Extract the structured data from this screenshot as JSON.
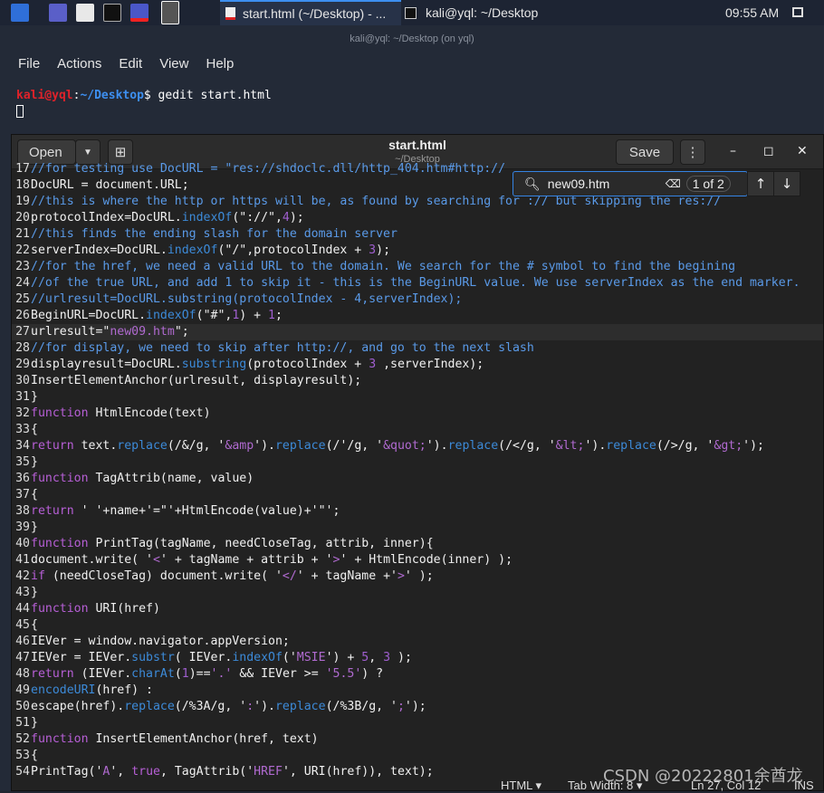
{
  "taskbar": {
    "tasks": [
      {
        "label": "start.html (~/Desktop) - ...",
        "icon": "text-file-icon"
      },
      {
        "label": "kali@yql: ~/Desktop",
        "icon": "terminal-icon"
      }
    ],
    "clock": "09:55 AM"
  },
  "terminal": {
    "title": "kali@yql: ~/Desktop (on yql)",
    "menu": [
      "File",
      "Actions",
      "Edit",
      "View",
      "Help"
    ],
    "prompt_user": "kali@yql",
    "prompt_sep": ":",
    "prompt_path": "~/Desktop",
    "prompt_sym": "$",
    "command": " gedit start.html"
  },
  "gedit": {
    "open_label": "Open",
    "title": "start.html",
    "subtitle": "~/Desktop",
    "save_label": "Save",
    "search": {
      "value": "new09.htm",
      "count": "1 of 2"
    },
    "lines": [
      {
        "n": "17",
        "segs": [
          [
            "//for testing use DocURL = \"res://shdoclc.dll/http_404.htm#http://",
            "c"
          ]
        ]
      },
      {
        "n": "18",
        "segs": [
          [
            "DocURL = document.URL;",
            ""
          ]
        ]
      },
      {
        "n": "19",
        "segs": [
          [
            "//this is where the http or https will be, as found by searching for :// but skipping the res://",
            "c"
          ]
        ]
      },
      {
        "n": "20",
        "segs": [
          [
            "protocolIndex=DocURL.",
            ""
          ],
          [
            "indexOf",
            "m"
          ],
          [
            "(\"://\",",
            ""
          ],
          [
            "4",
            "n"
          ],
          [
            ");",
            ""
          ]
        ]
      },
      {
        "n": "21",
        "segs": [
          [
            "//this finds the ending slash for the domain server",
            "c"
          ]
        ]
      },
      {
        "n": "22",
        "segs": [
          [
            "serverIndex=DocURL.",
            ""
          ],
          [
            "indexOf",
            "m"
          ],
          [
            "(\"/\",protocolIndex + ",
            ""
          ],
          [
            "3",
            "n"
          ],
          [
            ");",
            ""
          ]
        ]
      },
      {
        "n": "23",
        "segs": [
          [
            "//for the href, we need a valid URL to the domain. We search for the # symbol to find the begining",
            "c"
          ]
        ]
      },
      {
        "n": "24",
        "segs": [
          [
            "//of the true URL, and add 1 to skip it - this is the BeginURL value. We use serverIndex as the end marker.",
            "c"
          ]
        ]
      },
      {
        "n": "25",
        "segs": [
          [
            "//urlresult=DocURL.substring(protocolIndex - 4,serverIndex);",
            "c"
          ]
        ]
      },
      {
        "n": "26",
        "segs": [
          [
            "BeginURL=DocURL.",
            ""
          ],
          [
            "indexOf",
            "m"
          ],
          [
            "(\"#\",",
            ""
          ],
          [
            "1",
            "n"
          ],
          [
            ") + ",
            ""
          ],
          [
            "1",
            "n"
          ],
          [
            ";",
            ""
          ]
        ]
      },
      {
        "n": "27",
        "segs": [
          [
            "urlresult=\"",
            ""
          ],
          [
            "new09.htm",
            "s"
          ],
          [
            "\";",
            ""
          ]
        ]
      },
      {
        "n": "28",
        "segs": [
          [
            "//for display, we need to skip after http://, and go to the next slash",
            "c"
          ]
        ]
      },
      {
        "n": "29",
        "segs": [
          [
            "displayresult=DocURL.",
            ""
          ],
          [
            "substring",
            "m"
          ],
          [
            "(protocolIndex + ",
            ""
          ],
          [
            "3",
            "n"
          ],
          [
            " ,serverIndex);",
            ""
          ]
        ]
      },
      {
        "n": "30",
        "segs": [
          [
            "InsertElementAnchor(urlresult, displayresult);",
            ""
          ]
        ]
      },
      {
        "n": "31",
        "segs": [
          [
            "}",
            ""
          ]
        ]
      },
      {
        "n": "32",
        "segs": [
          [
            "function",
            "k"
          ],
          [
            " HtmlEncode(text)",
            ""
          ]
        ]
      },
      {
        "n": "33",
        "segs": [
          [
            "{",
            ""
          ]
        ]
      },
      {
        "n": "34",
        "segs": [
          [
            "return",
            "k"
          ],
          [
            " text.",
            ""
          ],
          [
            "replace",
            "m"
          ],
          [
            "(/&/g, '",
            ""
          ],
          [
            "&amp",
            "s"
          ],
          [
            "').",
            ""
          ],
          [
            "replace",
            "m"
          ],
          [
            "(/'/g, '",
            ""
          ],
          [
            "&quot;",
            "s"
          ],
          [
            "').",
            ""
          ],
          [
            "replace",
            "m"
          ],
          [
            "(/</g, '",
            ""
          ],
          [
            "&lt;",
            "s"
          ],
          [
            "').",
            ""
          ],
          [
            "replace",
            "m"
          ],
          [
            "(/>/g, '",
            ""
          ],
          [
            "&gt;",
            "s"
          ],
          [
            "');",
            ""
          ]
        ]
      },
      {
        "n": "35",
        "segs": [
          [
            "}",
            ""
          ]
        ]
      },
      {
        "n": "36",
        "segs": [
          [
            "function",
            "k"
          ],
          [
            " TagAttrib(name, value)",
            ""
          ]
        ]
      },
      {
        "n": "37",
        "segs": [
          [
            "{",
            ""
          ]
        ]
      },
      {
        "n": "38",
        "segs": [
          [
            "return",
            "k"
          ],
          [
            " ' '+name+'=\"'+HtmlEncode(value)+'\"';",
            ""
          ]
        ]
      },
      {
        "n": "39",
        "segs": [
          [
            "}",
            ""
          ]
        ]
      },
      {
        "n": "40",
        "segs": [
          [
            "function",
            "k"
          ],
          [
            " PrintTag(tagName, needCloseTag, attrib, inner){",
            ""
          ]
        ]
      },
      {
        "n": "41",
        "segs": [
          [
            "document.write( '",
            ""
          ],
          [
            "<",
            "s"
          ],
          [
            "' + tagName + attrib + '",
            ""
          ],
          [
            ">",
            "s"
          ],
          [
            "' + HtmlEncode(inner) );",
            ""
          ]
        ]
      },
      {
        "n": "42",
        "segs": [
          [
            "if",
            "k"
          ],
          [
            " (needCloseTag) document.write( '",
            ""
          ],
          [
            "</",
            "s"
          ],
          [
            "' + tagName +'",
            ""
          ],
          [
            ">",
            "s"
          ],
          [
            "' );",
            ""
          ]
        ]
      },
      {
        "n": "43",
        "segs": [
          [
            "}",
            ""
          ]
        ]
      },
      {
        "n": "44",
        "segs": [
          [
            "function",
            "k"
          ],
          [
            " URI(href)",
            ""
          ]
        ]
      },
      {
        "n": "45",
        "segs": [
          [
            "{",
            ""
          ]
        ]
      },
      {
        "n": "46",
        "segs": [
          [
            "IEVer = window.navigator.appVersion;",
            ""
          ]
        ]
      },
      {
        "n": "47",
        "segs": [
          [
            "IEVer = IEVer.",
            ""
          ],
          [
            "substr",
            "m"
          ],
          [
            "( IEVer.",
            ""
          ],
          [
            "indexOf",
            "m"
          ],
          [
            "('",
            ""
          ],
          [
            "MSIE",
            "s"
          ],
          [
            "') + ",
            ""
          ],
          [
            "5",
            "n"
          ],
          [
            ", ",
            ""
          ],
          [
            "3",
            "n"
          ],
          [
            " );",
            ""
          ]
        ]
      },
      {
        "n": "48",
        "segs": [
          [
            "return",
            "k"
          ],
          [
            " (IEVer.",
            ""
          ],
          [
            "charAt",
            "m"
          ],
          [
            "(",
            ""
          ],
          [
            "1",
            "n"
          ],
          [
            ")==",
            ""
          ],
          [
            "'.'",
            "s"
          ],
          [
            " && IEVer >= ",
            ""
          ],
          [
            "'5.5'",
            "s"
          ],
          [
            ") ?",
            ""
          ]
        ]
      },
      {
        "n": "49",
        "segs": [
          [
            "encodeURI",
            "m"
          ],
          [
            "(href) :",
            ""
          ]
        ]
      },
      {
        "n": "50",
        "segs": [
          [
            "escape(href).",
            ""
          ],
          [
            "replace",
            "m"
          ],
          [
            "(/%3A/g, '",
            ""
          ],
          [
            ":",
            "s"
          ],
          [
            "').",
            ""
          ],
          [
            "replace",
            "m"
          ],
          [
            "(/%3B/g, '",
            ""
          ],
          [
            ";",
            "s"
          ],
          [
            "');",
            ""
          ]
        ]
      },
      {
        "n": "51",
        "segs": [
          [
            "}",
            ""
          ]
        ]
      },
      {
        "n": "52",
        "segs": [
          [
            "function",
            "k"
          ],
          [
            " InsertElementAnchor(href, text)",
            ""
          ]
        ]
      },
      {
        "n": "53",
        "segs": [
          [
            "{",
            ""
          ]
        ]
      },
      {
        "n": "54",
        "segs": [
          [
            "PrintTag('",
            ""
          ],
          [
            "A",
            "s"
          ],
          [
            "', ",
            ""
          ],
          [
            "true",
            "k"
          ],
          [
            ", TagAttrib('",
            ""
          ],
          [
            "HREF",
            "s"
          ],
          [
            "', URI(href)), text);",
            ""
          ]
        ]
      }
    ],
    "current_line": "27",
    "status": {
      "lang": "HTML ▾",
      "tab": "Tab Width: 8 ▾",
      "pos": "Ln 27, Col 12",
      "mode": "INS"
    }
  },
  "watermark": "CSDN @20222801余酋龙",
  "colors": {
    "accent": "#3584e4",
    "comment": "#5a9ae8",
    "keyword": "#b75fd6",
    "prompt_user": "#e0222a",
    "prompt_path": "#3d8ff0"
  }
}
